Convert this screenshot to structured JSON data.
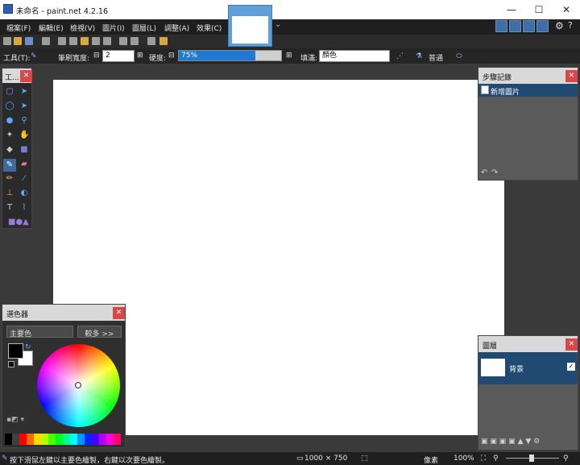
{
  "window": {
    "title": "未命名 - paint.net 4.2.16",
    "minimize": "—",
    "maximize": "☐",
    "close": "✕"
  },
  "menus": [
    "檔案(F)",
    "編輯(E)",
    "檢視(V)",
    "圖片(I)",
    "圖層(L)",
    "調整(A)",
    "效果(C)"
  ],
  "toolbar": {
    "tool_label": "工具(T):",
    "brush_width_label": "筆刷寬度:",
    "brush_width_value": "2",
    "hardness_label": "硬度:",
    "hardness_value": "75%",
    "hardness_fraction": 0.75,
    "fill_label": "填滿:",
    "fill_value": "顏色",
    "blend_label": "普通"
  },
  "tools_panel": {
    "title": "工..."
  },
  "history_panel": {
    "title": "步驟記錄",
    "items": [
      "新增圖片"
    ]
  },
  "layers_panel": {
    "title": "圖層",
    "layers": [
      {
        "name": "背景",
        "visible": true
      }
    ]
  },
  "colors_panel": {
    "title": "選色器",
    "mode_select": "主要色",
    "more_button": "較多 >>",
    "primary_color": "#000000",
    "secondary_color": "#ffffff"
  },
  "statusbar": {
    "hint": "按下滑鼠左鍵以主要色繪製，右鍵以次要色繪製。",
    "image_size": "1000 × 750",
    "units": "像素",
    "zoom": "100%"
  },
  "colors": {
    "accent": "#1e78d4",
    "tab": "#5fa0d8",
    "close": "#d94848",
    "selected_row": "#214a73"
  }
}
